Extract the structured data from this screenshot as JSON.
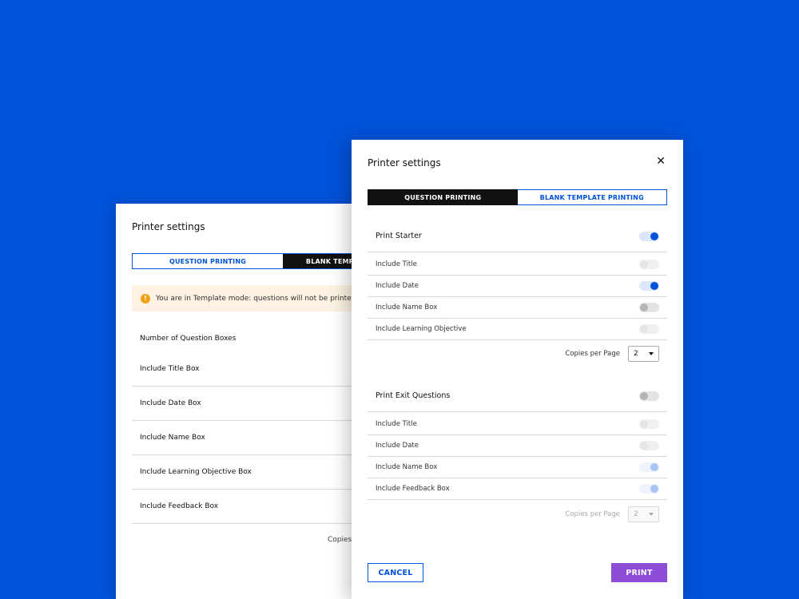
{
  "back_panel": {
    "title": "Printer settings",
    "tabs": [
      "QUESTION PRINTING",
      "BLANK TEMPLATE PRINTING"
    ],
    "banner": "You are in Template mode: questions will not be printed",
    "rows": [
      "Number of Question Boxes",
      "Include Title Box",
      "Include Date Box",
      "Include Name Box",
      "Include Learning Objective Box",
      "Include Feedback Box"
    ],
    "copies_label": "Copies per Page"
  },
  "front_panel": {
    "title": "Printer settings",
    "tabs": [
      "QUESTION PRINTING",
      "BLANK TEMPLATE PRINTING"
    ],
    "starter": {
      "label": "Print Starter",
      "state": "on",
      "items": [
        {
          "label": "Include Title",
          "state": "disabled"
        },
        {
          "label": "Include Date",
          "state": "on"
        },
        {
          "label": "Include Name Box",
          "state": "off"
        },
        {
          "label": "Include Learning Objective",
          "state": "disabled"
        }
      ],
      "copies_label": "Copies per Page",
      "copies_value": "2"
    },
    "exit": {
      "label": "Print Exit Questions",
      "state": "off",
      "items": [
        {
          "label": "Include Title",
          "state": "disabled"
        },
        {
          "label": "Include Date",
          "state": "disabled"
        },
        {
          "label": "Include Name Box",
          "state": "on-disabled"
        },
        {
          "label": "Include Feedback Box",
          "state": "on-disabled"
        }
      ],
      "copies_label": "Copies per Page",
      "copies_value": "2"
    },
    "cancel_label": "CANCEL",
    "print_label": "PRINT"
  },
  "colors": {
    "background": "#0052d9",
    "accent": "#0052d9",
    "print_button": "#8d4cd6",
    "warning": "#f3a012"
  }
}
